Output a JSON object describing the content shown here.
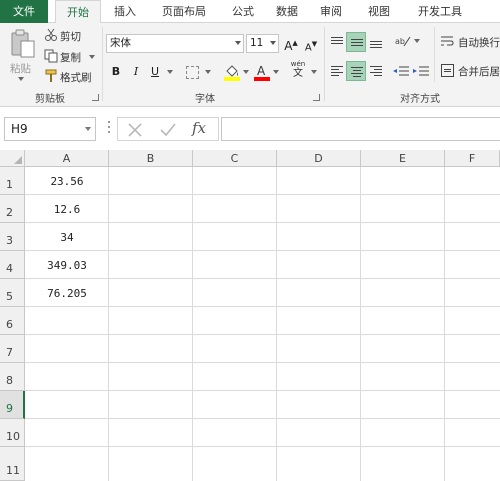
{
  "ribbon_tabs": [
    {
      "label": "文件"
    },
    {
      "label": "开始"
    },
    {
      "label": "插入"
    },
    {
      "label": "页面布局"
    },
    {
      "label": "公式"
    },
    {
      "label": "数据"
    },
    {
      "label": "审阅"
    },
    {
      "label": "视图"
    },
    {
      "label": "开发工具"
    }
  ],
  "active_tab": "开始",
  "clipboard": {
    "paste": "粘贴",
    "cut": "剪切",
    "copy": "复制",
    "format_painter": "格式刷",
    "group_label": "剪贴板"
  },
  "font": {
    "name": "宋体",
    "size": "11",
    "grow": "A",
    "shrink": "A",
    "bold": "B",
    "italic": "I",
    "underline": "U",
    "phonetic": "wén",
    "group_label": "字体",
    "fill_color": "#ffff00",
    "font_color": "#ff0000"
  },
  "alignment": {
    "wrap_text": "自动换行",
    "merge_center": "合并后居",
    "group_label": "对齐方式"
  },
  "formula_bar": {
    "name_box": "H9",
    "fx": "fx",
    "formula": ""
  },
  "columns": [
    "A",
    "B",
    "C",
    "D",
    "E",
    "F"
  ],
  "rows": [
    "1",
    "2",
    "3",
    "4",
    "5",
    "6",
    "7",
    "8",
    "9",
    "10",
    "11"
  ],
  "selected_row": "9",
  "cells": {
    "A1": "23.56",
    "A2": "12.6",
    "A3": "34",
    "A4": "349.03",
    "A5": "76.205"
  },
  "theme": {
    "accent": "#217346",
    "selected_align": "#a7d3b9"
  }
}
